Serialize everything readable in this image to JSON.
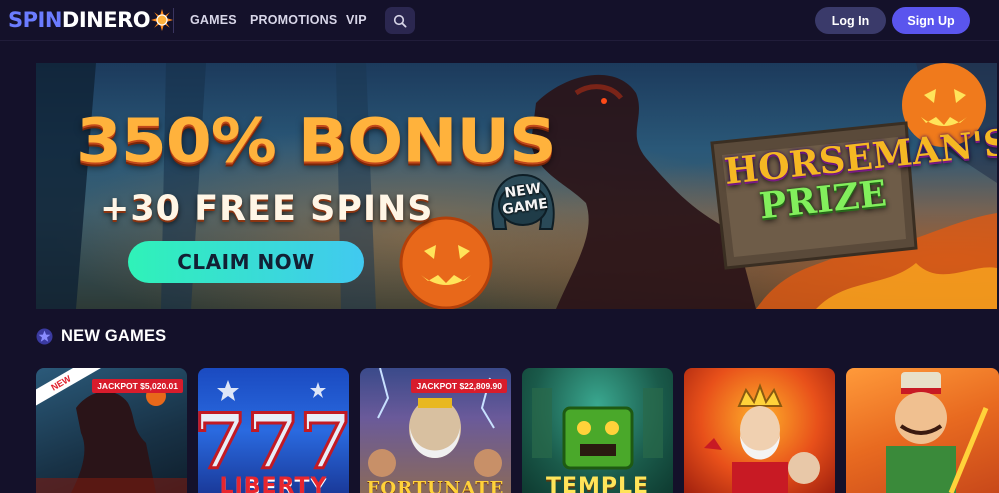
{
  "header": {
    "logo_part1": "SPIN",
    "logo_part2": "DINERO",
    "nav": [
      {
        "label": "GAMES"
      },
      {
        "label": "PROMOTIONS"
      },
      {
        "label": "VIP"
      }
    ],
    "search_icon": "search-icon",
    "login_label": "Log In",
    "signup_label": "Sign Up"
  },
  "banner": {
    "headline": "350% BONUS",
    "subline": "+30 FREE SPINS",
    "cta_label": "CLAIM NOW",
    "badge_line1": "NEW",
    "badge_line2": "GAME",
    "game_title_line1": "HORSEMAN'S",
    "game_title_line2": "PRIZE"
  },
  "section": {
    "title": "NEW GAMES",
    "icon": "star-badge-icon"
  },
  "games": [
    {
      "ribbon": "NEW",
      "jackpot": "JACKPOT $5,020.01",
      "title_fragment": ""
    },
    {
      "ribbon": "",
      "jackpot": "",
      "title_fragment": "LIBERTY"
    },
    {
      "ribbon": "",
      "jackpot": "JACKPOT $22,809.90",
      "title_fragment": "FORTUNATE"
    },
    {
      "ribbon": "",
      "jackpot": "",
      "title_fragment": "TEMPLE"
    },
    {
      "ribbon": "",
      "jackpot": "",
      "title_fragment": ""
    },
    {
      "ribbon": "",
      "jackpot": "",
      "title_fragment": ""
    }
  ],
  "colors": {
    "background": "#14112a",
    "accent": "#5a55ee",
    "logo_blue": "#6b7cff",
    "cta_gradient_start": "#2ff2b8",
    "cta_gradient_end": "#41c9f0",
    "jackpot_red": "#d81c2c"
  }
}
